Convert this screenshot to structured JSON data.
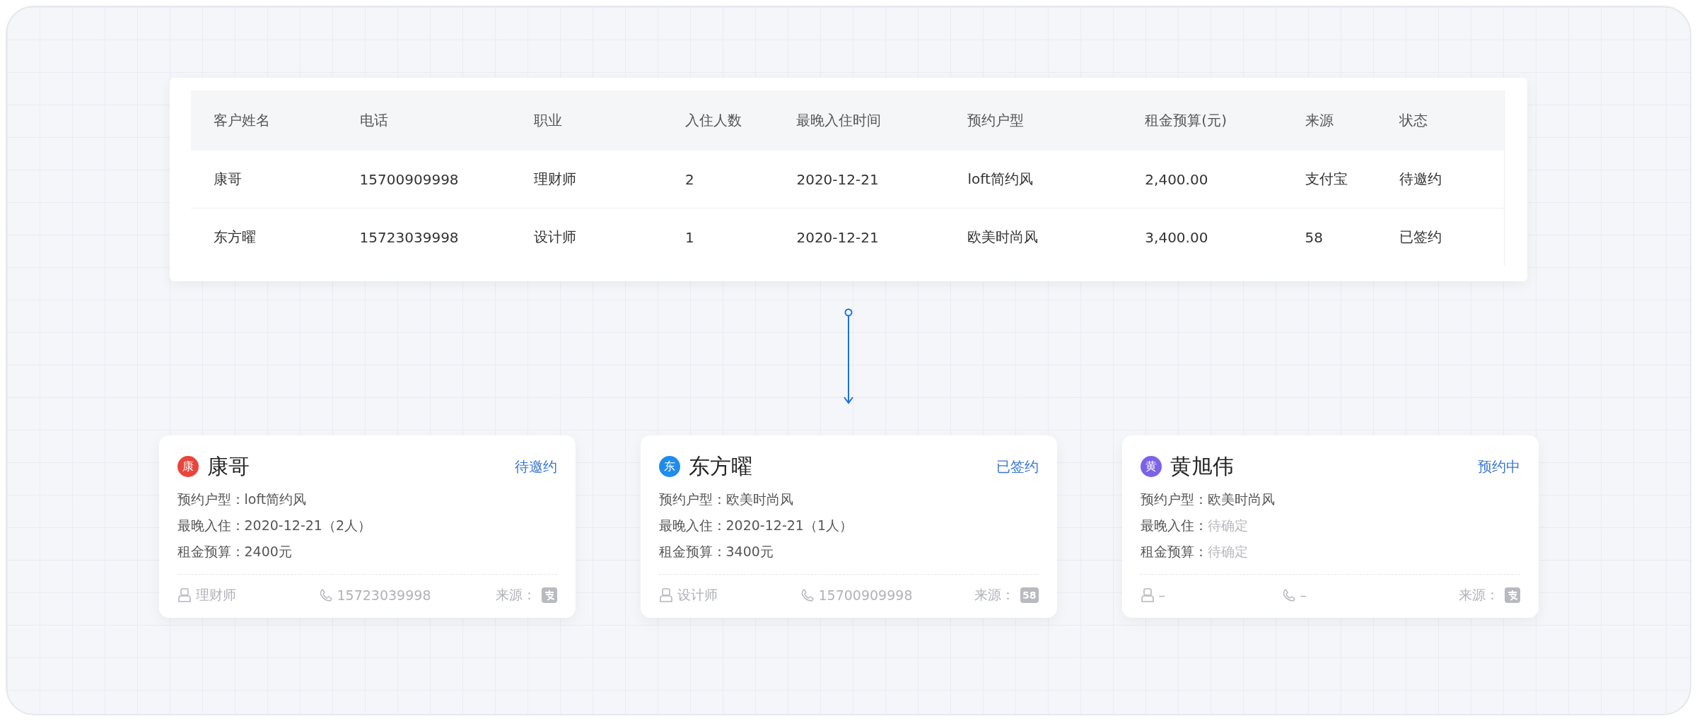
{
  "table": {
    "columns": [
      "客户姓名",
      "电话",
      "职业",
      "入住人数",
      "最晚入住时间",
      "预约户型",
      "租金预算(元)",
      "来源",
      "状态"
    ],
    "rows": [
      [
        "康哥",
        "15700909998",
        "理财师",
        "2",
        "2020-12-21",
        "loft简约风",
        "2,400.00",
        "支付宝",
        "待邀约"
      ],
      [
        "东方曜",
        "15723039998",
        "设计师",
        "1",
        "2020-12-21",
        "欧美时尚风",
        "3,400.00",
        "58",
        "已签约"
      ]
    ]
  },
  "cards": [
    {
      "avatar": "康",
      "color": "#e8453c",
      "name": "康哥",
      "status": "待邀约",
      "fields": [
        {
          "label": "预约户型：",
          "value": "loft简约风",
          "pending": false
        },
        {
          "label": "最晚入住：",
          "value": "2020-12-21（2人）",
          "pending": false
        },
        {
          "label": "租金预算：",
          "value": "2400元",
          "pending": false
        }
      ],
      "job": "理财师",
      "phone": "15723039998",
      "source_label": "来源：",
      "source": {
        "kind": "alipay"
      }
    },
    {
      "avatar": "东",
      "color": "#1f8cec",
      "name": "东方曜",
      "status": "已签约",
      "fields": [
        {
          "label": "预约户型：",
          "value": "欧美时尚风",
          "pending": false
        },
        {
          "label": "最晚入住：",
          "value": "2020-12-21（1人）",
          "pending": false
        },
        {
          "label": "租金预算：",
          "value": "3400元",
          "pending": false
        }
      ],
      "job": "设计师",
      "phone": "15700909998",
      "source_label": "来源：",
      "source": {
        "kind": "badge",
        "text": "58"
      }
    },
    {
      "avatar": "黄",
      "color": "#7d62e8",
      "name": "黄旭伟",
      "status": "预约中",
      "fields": [
        {
          "label": "预约户型：",
          "value": "欧美时尚风",
          "pending": false
        },
        {
          "label": "最晚入住：",
          "value": "待确定",
          "pending": true
        },
        {
          "label": "租金预算：",
          "value": "待确定",
          "pending": true
        }
      ],
      "job": "–",
      "phone": "–",
      "source_label": "来源：",
      "source": {
        "kind": "alipay"
      }
    }
  ]
}
